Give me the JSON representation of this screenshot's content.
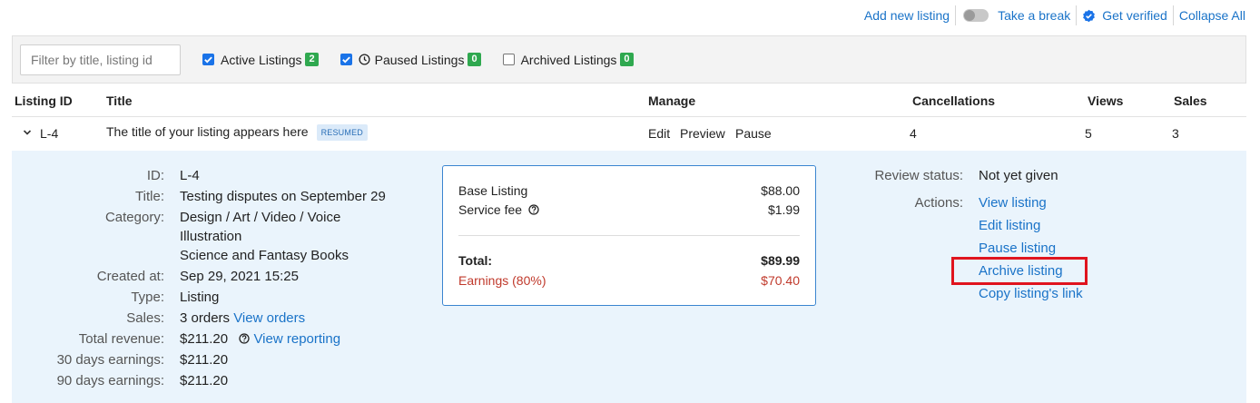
{
  "topbar": {
    "add_new_listing": "Add new listing",
    "take_a_break": "Take a break",
    "get_verified": "Get verified",
    "collapse_all": "Collapse All"
  },
  "filters": {
    "search_placeholder": "Filter by title, listing id",
    "active": {
      "label": "Active Listings",
      "count": "2",
      "checked": true
    },
    "paused": {
      "label": "Paused Listings",
      "count": "0",
      "checked": true
    },
    "archived": {
      "label": "Archived Listings",
      "count": "0",
      "checked": false
    }
  },
  "table": {
    "headers": {
      "listing_id": "Listing ID",
      "title": "Title",
      "manage": "Manage",
      "cancellations": "Cancellations",
      "views": "Views",
      "sales": "Sales"
    },
    "row": {
      "id": "L-4",
      "title": "The title of your listing appears here",
      "badge": "RESUMED",
      "actions": {
        "edit": "Edit",
        "preview": "Preview",
        "pause": "Pause"
      },
      "cancellations": "4",
      "views": "5",
      "sales": "3"
    }
  },
  "details": {
    "id": {
      "label": "ID:",
      "value": "L-4"
    },
    "title": {
      "label": "Title:",
      "value": "Testing disputes on September 29"
    },
    "category": {
      "label": "Category:",
      "line1": "Design / Art / Video / Voice",
      "line2": "Illustration",
      "line3": "Science and Fantasy Books"
    },
    "created": {
      "label": "Created at:",
      "value": "Sep 29, 2021 15:25"
    },
    "type": {
      "label": "Type:",
      "value": "Listing"
    },
    "sales": {
      "label": "Sales:",
      "value": "3 orders",
      "link": "View orders"
    },
    "total_revenue": {
      "label": "Total revenue:",
      "value": "$211.20",
      "link": "View reporting"
    },
    "earnings_30": {
      "label": "30 days earnings:",
      "value": "$211.20"
    },
    "earnings_90": {
      "label": "90 days earnings:",
      "value": "$211.20"
    }
  },
  "price": {
    "base_label": "Base Listing",
    "base_value": "$88.00",
    "fee_label": "Service fee",
    "fee_value": "$1.99",
    "total_label": "Total:",
    "total_value": "$89.99",
    "earnings_label": "Earnings (80%)",
    "earnings_value": "$70.40"
  },
  "review": {
    "status_label": "Review status:",
    "status_value": "Not yet given",
    "actions_label": "Actions:",
    "actions": [
      "View listing",
      "Edit listing",
      "Pause listing",
      "Archive listing",
      "Copy listing's link"
    ]
  },
  "colors": {
    "link": "#1a73c8",
    "badge_green": "#2fa84f",
    "panel_bg": "#eaf4fc",
    "highlight": "#e0141e",
    "earnings_red": "#c0392b"
  }
}
